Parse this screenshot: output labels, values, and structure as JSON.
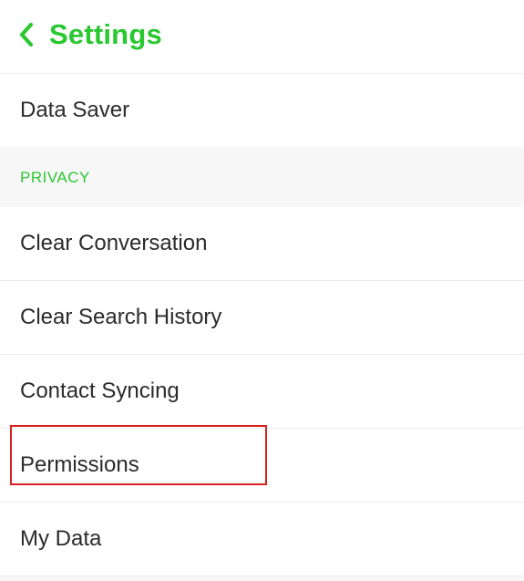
{
  "header": {
    "title": "Settings"
  },
  "accent_color": "#29c730",
  "rows": {
    "data_saver": "Data Saver",
    "clear_conversation": "Clear Conversation",
    "clear_search_history": "Clear Search History",
    "contact_syncing": "Contact Syncing",
    "permissions": "Permissions",
    "my_data": "My Data"
  },
  "sections": {
    "privacy": "PRIVACY"
  },
  "highlight": {
    "target": "permissions"
  }
}
